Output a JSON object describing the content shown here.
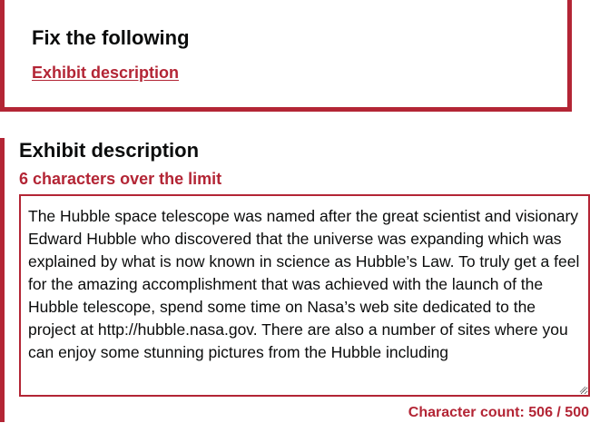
{
  "error_summary": {
    "title": "Fix the following",
    "links": [
      "Exhibit description"
    ]
  },
  "field": {
    "label": "Exhibit description",
    "error_message": "6 characters over the limit",
    "value": "The Hubble space telescope was named after the great scientist and visionary Edward Hubble who discovered that the universe was expanding which was explained by what is now known in science as Hubble’s Law. To truly get a feel for the amazing accomplishment that was achieved with the launch of the Hubble telescope, spend some time on Nasa’s web site dedicated to the project at http://hubble.nasa.gov. There are also a number of sites where you can enjoy some stunning pictures from the Hubble including",
    "character_count": "Character count: 506 / 500"
  },
  "colors": {
    "error": "#b32535",
    "text": "#0b0c0c"
  }
}
